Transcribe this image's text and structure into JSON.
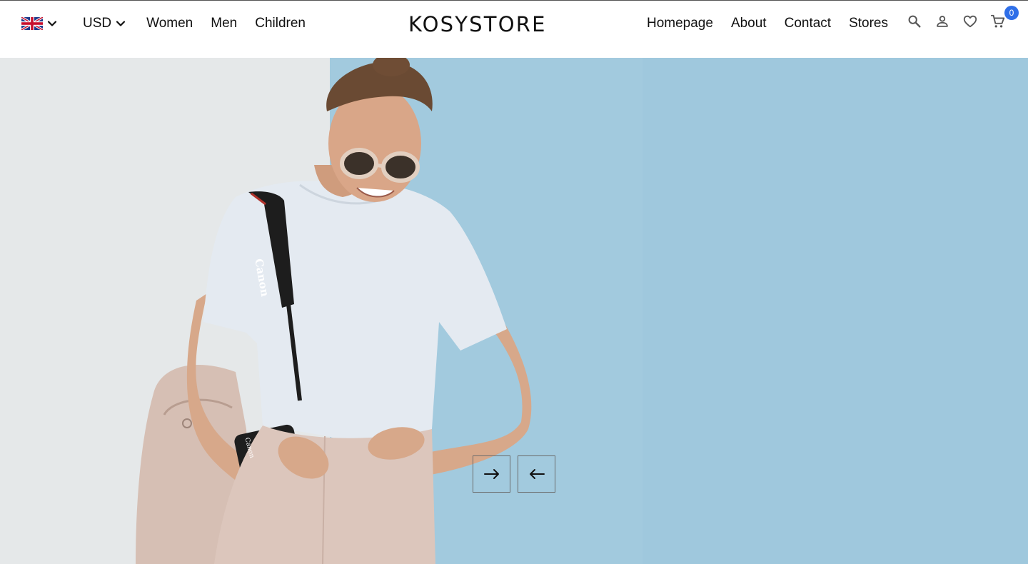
{
  "header": {
    "language": {
      "flag_icon": "uk-flag-icon",
      "chevron_icon": "chevron-down-icon"
    },
    "currency": {
      "label": "USD",
      "chevron_icon": "chevron-down-icon"
    },
    "left_links": [
      {
        "label": "Women"
      },
      {
        "label": "Men"
      },
      {
        "label": "Children"
      }
    ],
    "brand": "KOSYSTORE",
    "right_links": [
      {
        "label": "Homepage"
      },
      {
        "label": "About"
      },
      {
        "label": "Contact"
      },
      {
        "label": "Stores"
      }
    ],
    "icons": {
      "search": "search-icon",
      "account": "person-icon",
      "wishlist": "heart-outline-icon",
      "cart": "shopping-cart-icon"
    },
    "cart_count": "0",
    "colors": {
      "badge": "#2f6fe8",
      "text": "#111111"
    }
  },
  "hero": {
    "image": "woman-with-camera-hero-image",
    "camera_strap_text": "Canon",
    "camera_body_text": "Canon",
    "controls": {
      "next_icon": "arrow-right-icon",
      "prev_icon": "arrow-left-icon"
    },
    "colors": {
      "wall_left": "#e4e7e8",
      "wall_right": "#a0c9de"
    }
  }
}
